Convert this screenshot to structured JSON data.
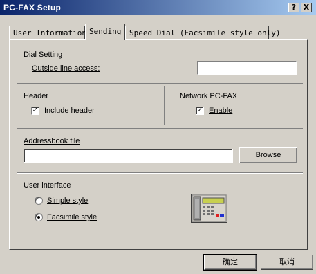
{
  "window": {
    "title": "PC-FAX Setup",
    "help_label": "?",
    "close_label": "X"
  },
  "tabs": [
    {
      "label": "User Information"
    },
    {
      "label": "Sending"
    },
    {
      "label": "Speed Dial (Facsimile style only)"
    }
  ],
  "dial_setting": {
    "heading": "Dial Setting",
    "outside_line_label": "Outside line access:",
    "outside_line_value": ""
  },
  "header_group": {
    "heading": "Header",
    "include_header_label": "Include header",
    "include_header_checked": true
  },
  "network_group": {
    "heading": "Network PC-FAX",
    "enable_label": "Enable",
    "enable_checked": true
  },
  "addressbook": {
    "label": "Addressbook file",
    "value": "",
    "browse_label": "Browse"
  },
  "user_interface": {
    "heading": "User interface",
    "options": [
      {
        "label": "Simple style",
        "selected": false
      },
      {
        "label": "Facsimile style",
        "selected": true
      }
    ],
    "preview_icon": "fax-machine-icon"
  },
  "footer": {
    "ok_label": "确定",
    "cancel_label": "取消"
  }
}
